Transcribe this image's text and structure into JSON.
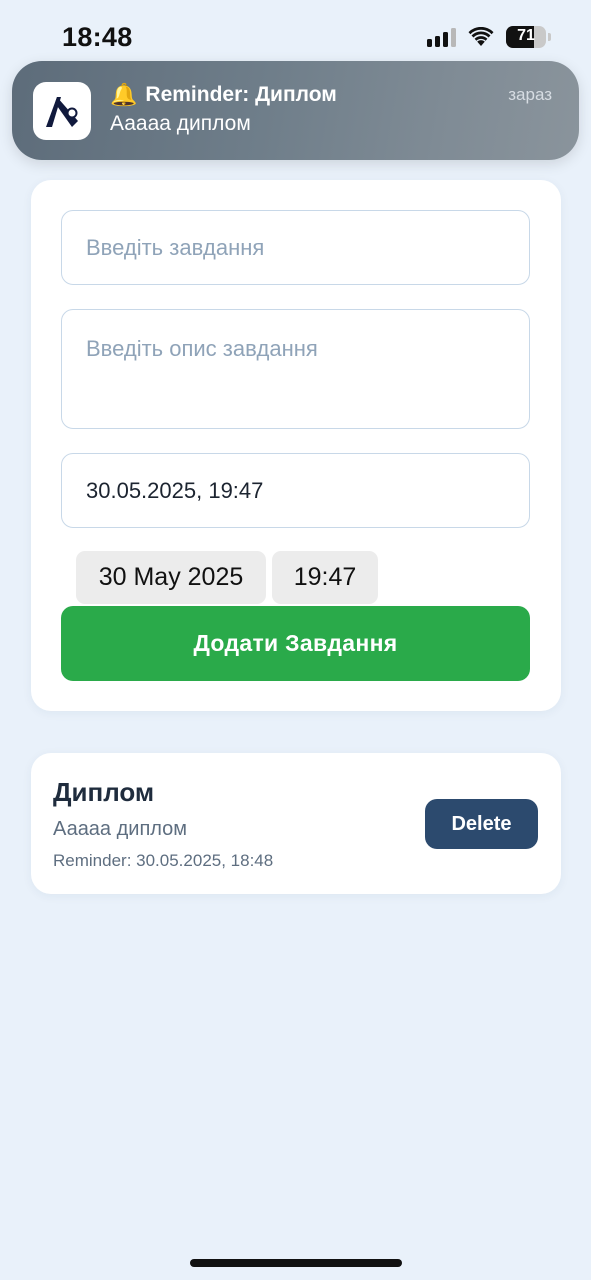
{
  "status_bar": {
    "time": "18:48",
    "battery": "71",
    "battery_level": 0.71,
    "icons": [
      "cellular-signal-icon",
      "wifi-icon",
      "battery-icon"
    ]
  },
  "notification": {
    "app_icon": "app-logo-icon",
    "bell": "🔔",
    "title": "Reminder: Диплом",
    "body": "Ааааа диплом",
    "time": "зараз"
  },
  "form": {
    "task_placeholder": "Введіть завдання",
    "description_placeholder": "Введіть опис завдання",
    "datetime_value": "30.05.2025, 19:47",
    "date_picker": "30 May 2025",
    "time_picker": "19:47",
    "add_button": "Додати Завдання"
  },
  "tasks": [
    {
      "title": "Диплом",
      "description": "Ааааа диплом",
      "reminder": "Reminder: 30.05.2025, 18:48",
      "delete_label": "Delete"
    }
  ],
  "colors": {
    "background": "#e9f1fa",
    "add_button": "#2aaa4a",
    "delete_button": "#2c4a6e",
    "placeholder": "#8fa3b8"
  }
}
